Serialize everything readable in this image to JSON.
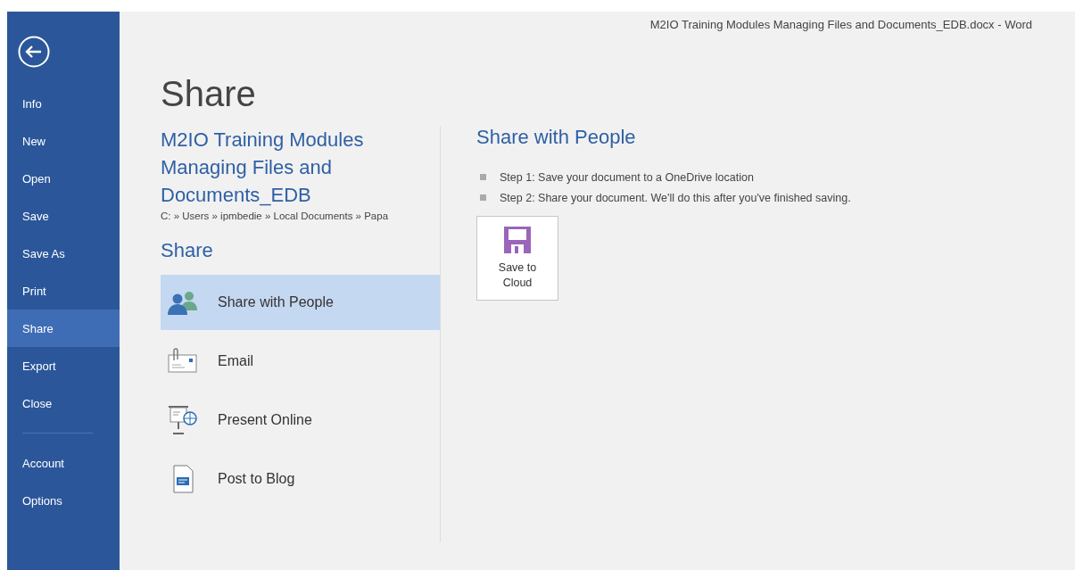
{
  "window": {
    "title": "M2IO Training Modules Managing Files and Documents_EDB.docx - Word"
  },
  "nav": {
    "groups": [
      [
        {
          "label": "Info",
          "selected": false
        },
        {
          "label": "New",
          "selected": false
        },
        {
          "label": "Open",
          "selected": false
        },
        {
          "label": "Save",
          "selected": false
        },
        {
          "label": "Save As",
          "selected": false
        },
        {
          "label": "Print",
          "selected": false
        },
        {
          "label": "Share",
          "selected": true
        },
        {
          "label": "Export",
          "selected": false
        },
        {
          "label": "Close",
          "selected": false
        }
      ],
      [
        {
          "label": "Account",
          "selected": false
        },
        {
          "label": "Options",
          "selected": false
        }
      ]
    ]
  },
  "page_title": "Share",
  "document": {
    "title": "M2IO Training Modules Managing Files and Documents_EDB",
    "path": "C: » Users » ipmbedie » Local Documents » Papa"
  },
  "section_title": "Share",
  "options": [
    {
      "kind": "people",
      "label": "Share with People",
      "selected": true
    },
    {
      "kind": "email",
      "label": "Email",
      "selected": false
    },
    {
      "kind": "present",
      "label": "Present Online",
      "selected": false
    },
    {
      "kind": "blog",
      "label": "Post to Blog",
      "selected": false
    }
  ],
  "detail": {
    "title": "Share with People",
    "steps": [
      "Step 1: Save your document to a OneDrive location",
      "Step 2: Share your document. We'll do this after you've finished saving."
    ],
    "button": {
      "line1": "Save to",
      "line2": "Cloud"
    }
  }
}
